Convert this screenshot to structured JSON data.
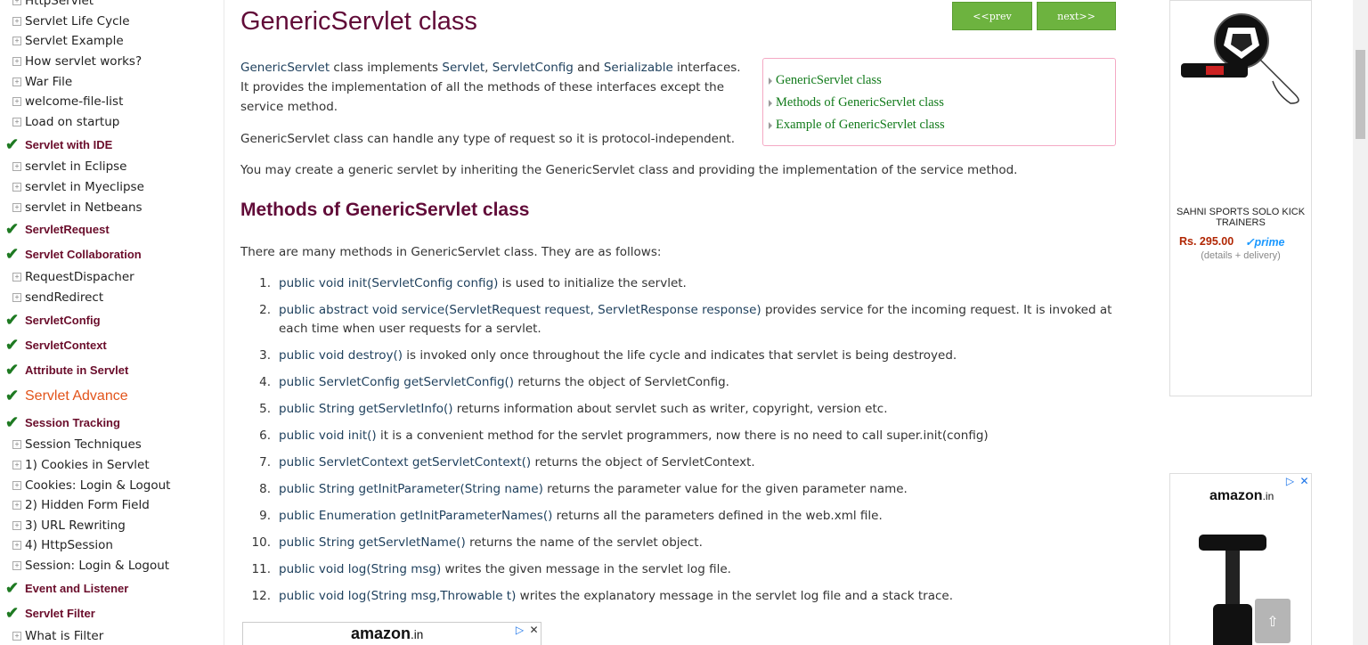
{
  "sidebar": {
    "items": [
      {
        "type": "sub",
        "label": "HttpServlet"
      },
      {
        "type": "sub",
        "label": "Servlet Life Cycle"
      },
      {
        "type": "sub",
        "label": "Servlet Example"
      },
      {
        "type": "sub",
        "label": "How servlet works?"
      },
      {
        "type": "sub",
        "label": "War File"
      },
      {
        "type": "sub",
        "label": "welcome-file-list"
      },
      {
        "type": "sub",
        "label": "Load on startup"
      },
      {
        "type": "head",
        "label": "Servlet with IDE"
      },
      {
        "type": "sub",
        "label": "servlet in Eclipse"
      },
      {
        "type": "sub",
        "label": "servlet in Myeclipse"
      },
      {
        "type": "sub",
        "label": "servlet in Netbeans"
      },
      {
        "type": "head",
        "label": "ServletRequest"
      },
      {
        "type": "head",
        "label": "Servlet Collaboration"
      },
      {
        "type": "sub",
        "label": "RequestDispacher"
      },
      {
        "type": "sub",
        "label": "sendRedirect"
      },
      {
        "type": "head",
        "label": "ServletConfig"
      },
      {
        "type": "head",
        "label": "ServletContext"
      },
      {
        "type": "head",
        "label": "Attribute in Servlet"
      },
      {
        "type": "head-big",
        "label": "Servlet Advance"
      },
      {
        "type": "head",
        "label": "Session Tracking"
      },
      {
        "type": "sub",
        "label": "Session Techniques"
      },
      {
        "type": "sub",
        "label": "1) Cookies in Servlet"
      },
      {
        "type": "sub",
        "label": "Cookies: Login & Logout"
      },
      {
        "type": "sub",
        "label": "2) Hidden Form Field"
      },
      {
        "type": "sub",
        "label": "3) URL Rewriting"
      },
      {
        "type": "sub",
        "label": "4) HttpSession"
      },
      {
        "type": "sub",
        "label": "Session: Login & Logout"
      },
      {
        "type": "head",
        "label": "Event and Listener"
      },
      {
        "type": "head",
        "label": "Servlet Filter"
      },
      {
        "type": "sub",
        "label": "What is Filter"
      }
    ]
  },
  "main": {
    "title": "GenericServlet class",
    "prev_label": "<<prev",
    "next_label": "next>>",
    "toc": [
      "GenericServlet class",
      "Methods of GenericServlet class",
      "Example of GenericServlet class"
    ],
    "intro": {
      "w1": "GenericServlet",
      "t1": " class implements ",
      "w2": "Servlet",
      "t2": ", ",
      "w3": "ServletConfig",
      "t3": " and ",
      "w4": "Serializable",
      "t4": " interfaces.",
      "line2": "It provides the implementation of all the methods of these interfaces except the",
      "line3": "service method."
    },
    "para2": "GenericServlet class can handle any type of request so it is protocol-independent.",
    "para3": "You may create a generic servlet by inheriting the GenericServlet class and providing the implementation of the service method.",
    "methods_heading": "Methods of GenericServlet class",
    "methods_intro": "There are many methods in GenericServlet class. They are as follows:",
    "methods": [
      {
        "num": "1.",
        "sig": "public void init(ServletConfig config)",
        "desc": " is used to initialize the servlet."
      },
      {
        "num": "2.",
        "sig": "public abstract void service(ServletRequest request, ServletResponse response)",
        "desc": " provides service for the incoming request. It is invoked at each time when user requests for a servlet."
      },
      {
        "num": "3.",
        "sig": "public void destroy()",
        "desc": " is invoked only once throughout the life cycle and indicates that servlet is being destroyed."
      },
      {
        "num": "4.",
        "sig": "public ServletConfig getServletConfig()",
        "desc": " returns the object of ServletConfig."
      },
      {
        "num": "5.",
        "sig": "public String getServletInfo()",
        "desc": " returns information about servlet such as writer, copyright, version etc."
      },
      {
        "num": "6.",
        "sig": "public void init()",
        "desc": " it is a convenient method for the servlet programmers, now there is no need to call super.init(config)"
      },
      {
        "num": "7.",
        "sig": "public ServletContext getServletContext()",
        "desc": " returns the object of ServletContext."
      },
      {
        "num": "8.",
        "sig": "public String getInitParameter(String name)",
        "desc": " returns the parameter value for the given parameter name."
      },
      {
        "num": "9.",
        "sig": "public Enumeration getInitParameterNames()",
        "desc": " returns all the parameters defined in the web.xml file."
      },
      {
        "num": "10.",
        "sig": "public String getServletName()",
        "desc": " returns the name of the servlet object."
      },
      {
        "num": "11.",
        "sig": "public void log(String msg)",
        "desc": " writes the given message in the servlet log file."
      },
      {
        "num": "12.",
        "sig": "public void log(String msg,Throwable t)",
        "desc": " writes the explanatory message in the servlet log file and a stack trace."
      }
    ]
  },
  "ads": {
    "brand": "amazon",
    "brand_suffix": ".in",
    "product_title": "SAHNI SPORTS SOLO KICK TRAINERS",
    "price": "Rs. 295.00",
    "prime": "✓prime",
    "details": "(details + delivery)",
    "close": "✕",
    "adchoice": "▷"
  },
  "scroll_top_label": "⇧"
}
